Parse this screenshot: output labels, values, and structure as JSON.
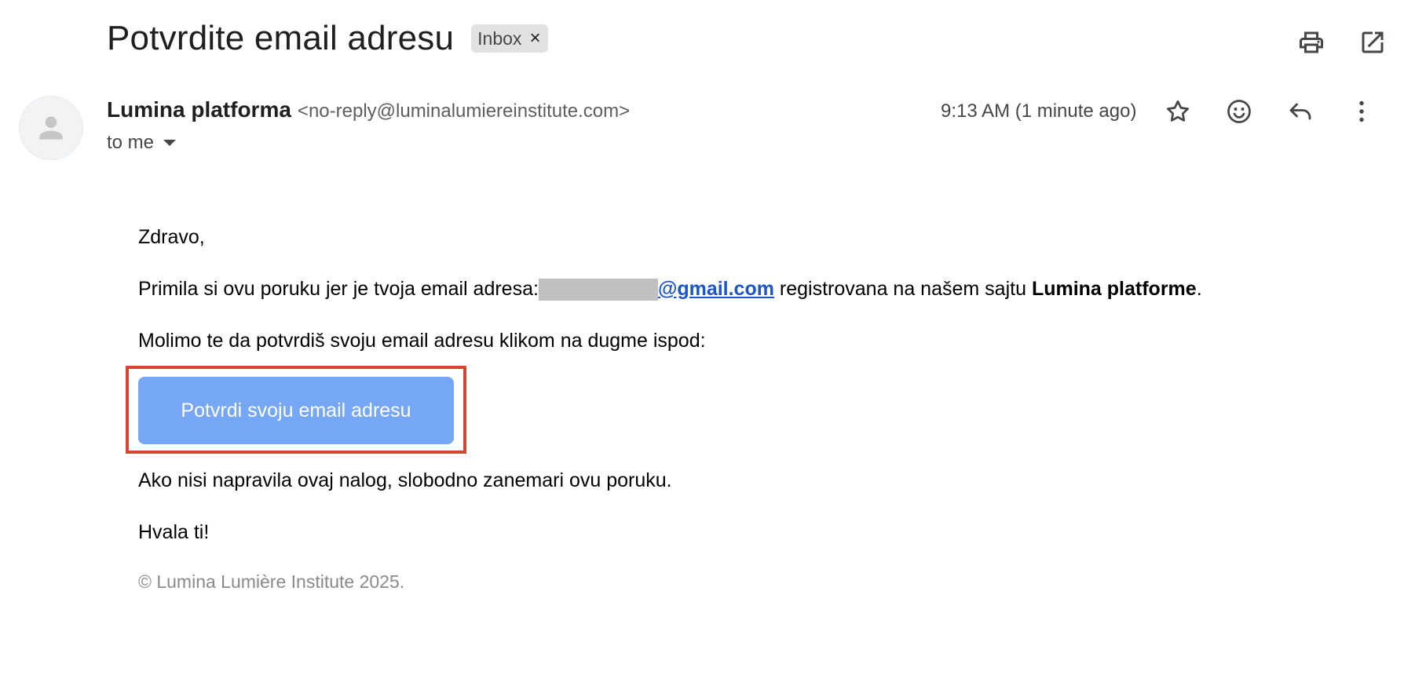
{
  "email": {
    "subject": "Potvrdite email adresu",
    "label": "Inbox",
    "label_remove": "×",
    "sender": {
      "name": "Lumina platforma",
      "address": "<no-reply@luminalumiereinstitute.com>"
    },
    "recipient": "to me",
    "time": "9:13 AM (1 minute ago)"
  },
  "icons": {
    "print": "print-icon",
    "open_new_window": "open-in-new-icon",
    "star": "star-icon",
    "emoji": "emoji-icon",
    "reply": "reply-icon",
    "more": "more-vert-icon",
    "avatar": "person-icon"
  },
  "body": {
    "greeting": "Zdravo,",
    "line1_prefix": "Primila si ovu poruku jer je tvoja email adresa:",
    "line1_email_domain": "@gmail.com",
    "line1_middle": " registrovana na našem sajtu ",
    "line1_brand": "Lumina platforme",
    "line1_end": ".",
    "line2": "Molimo te da potvrdiš svoju email adresu klikom na dugme ispod:",
    "cta_label": "Potvrdi svoju email adresu",
    "line3": "Ako nisi napravila ovaj nalog, slobodno zanemari ovu poruku.",
    "thanks": "Hvala ti!",
    "footer": "© Lumina Lumière Institute 2025."
  },
  "colors": {
    "cta_background": "#76a7f5",
    "highlight_border": "#d94432",
    "link": "#1a55c9"
  }
}
